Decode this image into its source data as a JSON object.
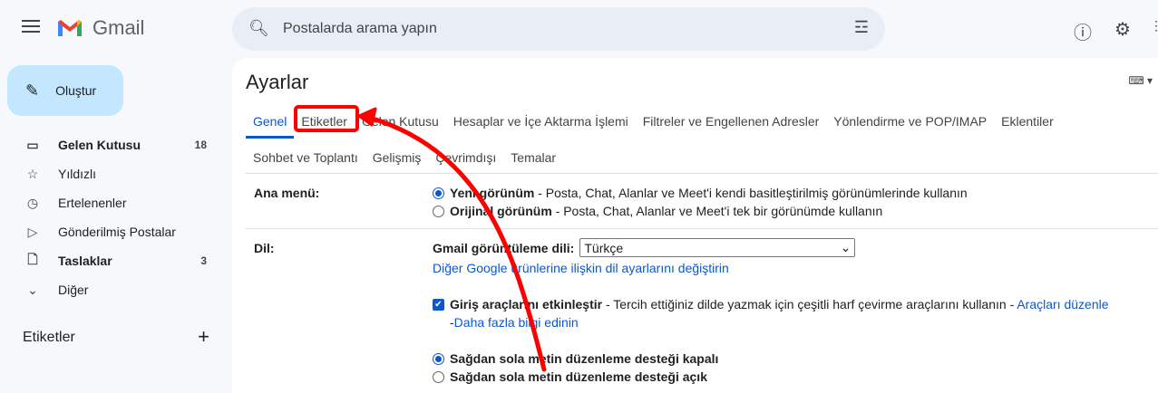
{
  "header": {
    "app_name": "Gmail",
    "search_placeholder": "Postalarda arama yapın"
  },
  "compose": "Oluştur",
  "nav": [
    {
      "label": "Gelen Kutusu",
      "count": "18",
      "icon": "inbox-icon",
      "bold": true
    },
    {
      "label": "Yıldızlı",
      "icon": "star-icon"
    },
    {
      "label": "Ertelenenler",
      "icon": "clock-icon"
    },
    {
      "label": "Gönderilmiş Postalar",
      "icon": "send-icon"
    },
    {
      "label": "Taslaklar",
      "count": "3",
      "icon": "draft-icon",
      "bold": true
    },
    {
      "label": "Diğer",
      "icon": "chevron-down-icon"
    }
  ],
  "labels_heading": "Etiketler",
  "settings": {
    "title": "Ayarlar",
    "tabs_row1": [
      "Genel",
      "Etiketler",
      "Gelen Kutusu",
      "Hesaplar ve İçe Aktarma İşlemi",
      "Filtreler ve Engellenen Adresler",
      "Yönlendirme ve POP/IMAP",
      "Eklentiler"
    ],
    "tabs_row2": [
      "Sohbet ve Toplantı",
      "Gelişmiş",
      "Çevrimdışı",
      "Temalar"
    ],
    "main_menu": {
      "label": "Ana menü:",
      "new_bold": "Yeni görünüm",
      "new_text": " - Posta, Chat, Alanlar ve Meet'i kendi basitleştirilmiş görünümlerinde kullanın",
      "orig_bold": "Orijinal görünüm",
      "orig_text": " - Posta, Chat, Alanlar ve Meet'i tek bir görünümde kullanın"
    },
    "language": {
      "label": "Dil:",
      "display_label": "Gmail görüntüleme dili:",
      "selected": "Türkçe",
      "other_link": "Diğer Google ürünlerine ilişkin dil ayarlarını değiştirin",
      "input_tools_bold": "Giriş araçlarını etkinleştir",
      "input_tools_text": " - Tercih ettiğiniz dilde yazmak için çeşitli harf çevirme araçlarını kullanın - ",
      "edit_tools_link": "Araçları düzenle",
      "dash": "- ",
      "learn_more": "Daha fazla bilgi edinin",
      "rtl_off": "Sağdan sola metin düzenleme desteği kapalı",
      "rtl_on": "Sağdan sola metin düzenleme desteği açık"
    }
  },
  "annotation_color": "#ff0000"
}
